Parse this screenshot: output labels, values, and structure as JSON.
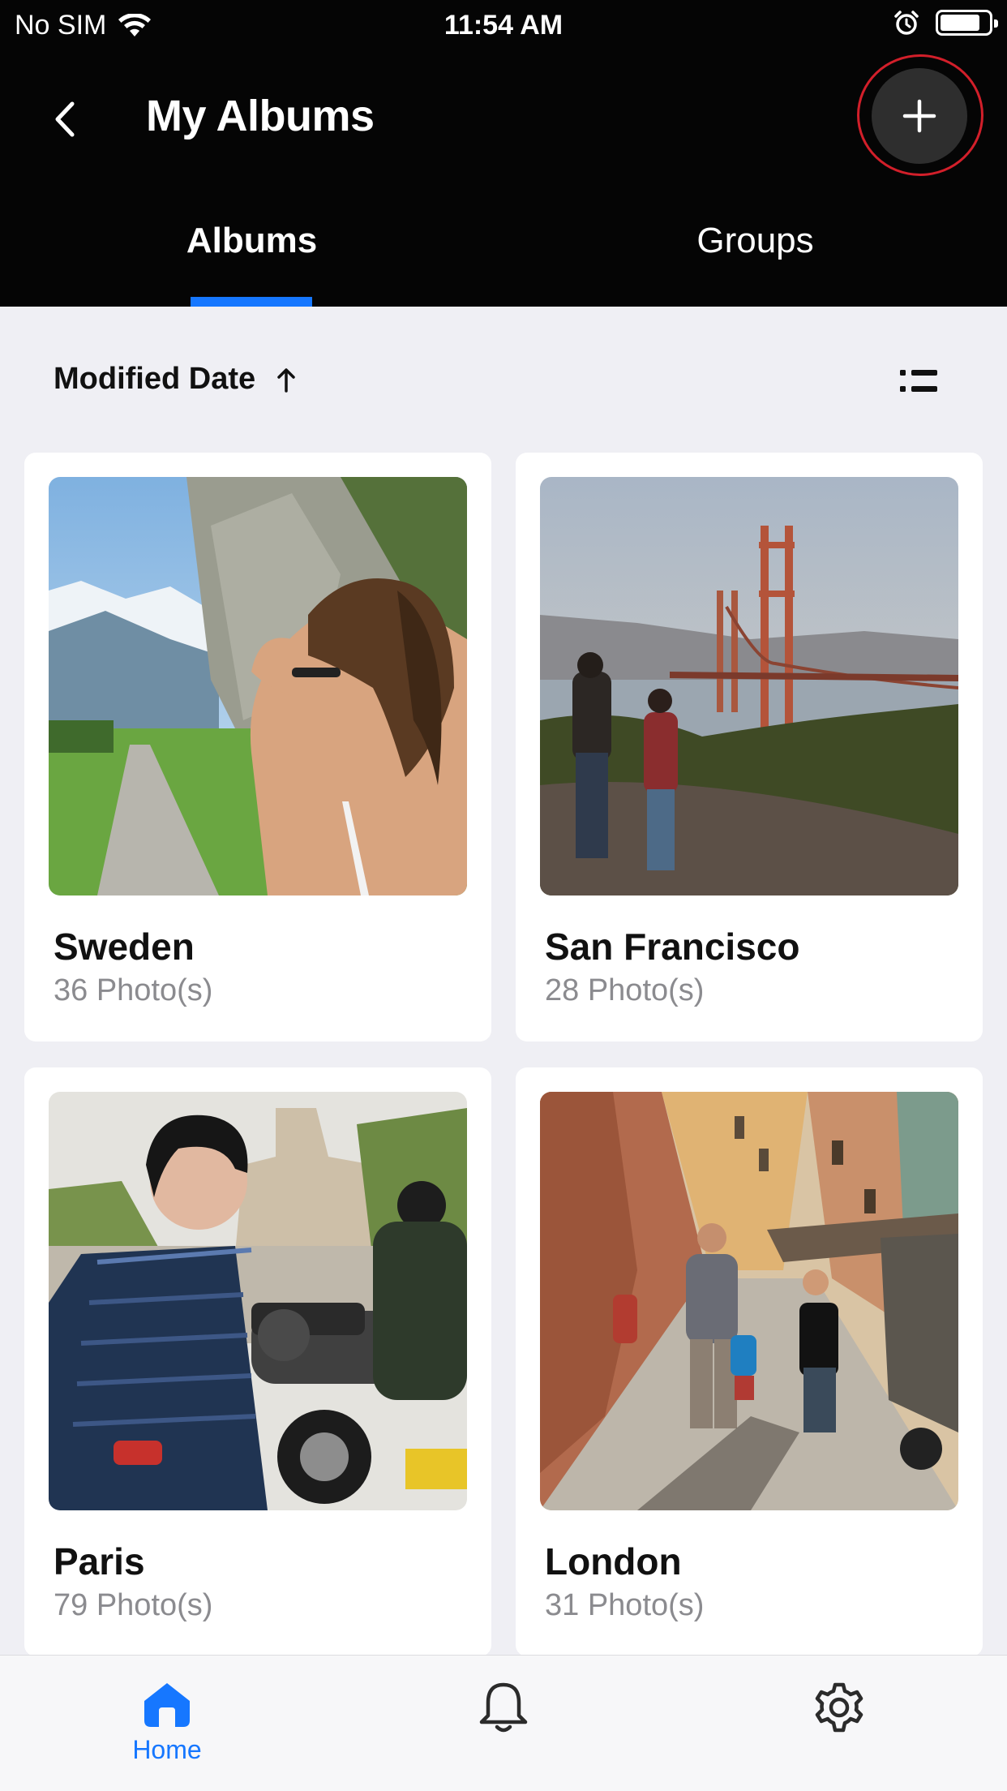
{
  "status_bar": {
    "carrier": "No SIM",
    "time": "11:54 AM",
    "battery_level": 0.85
  },
  "nav": {
    "title": "My Albums"
  },
  "tabs": [
    {
      "label": "Albums",
      "selected": true
    },
    {
      "label": "Groups",
      "selected": false
    }
  ],
  "sort": {
    "label": "Modified Date",
    "direction": "ascending"
  },
  "albums": [
    {
      "name": "Sweden",
      "count": "36 Photo(s)"
    },
    {
      "name": "San Francisco",
      "count": "28 Photo(s)"
    },
    {
      "name": "Paris",
      "count": "79 Photo(s)"
    },
    {
      "name": "London",
      "count": "31 Photo(s)"
    }
  ],
  "bottom_nav": {
    "home_label": "Home"
  },
  "colors": {
    "accent": "#1677ff",
    "header_bg": "#050505",
    "highlight_ring": "#d21f2a",
    "page_bg": "#efeff4"
  },
  "icons": [
    "wifi-icon",
    "alarm-icon",
    "battery-icon",
    "back-chevron-icon",
    "plus-icon",
    "sort-arrow-up-icon",
    "list-view-icon",
    "home-icon",
    "bell-icon",
    "gear-icon"
  ]
}
